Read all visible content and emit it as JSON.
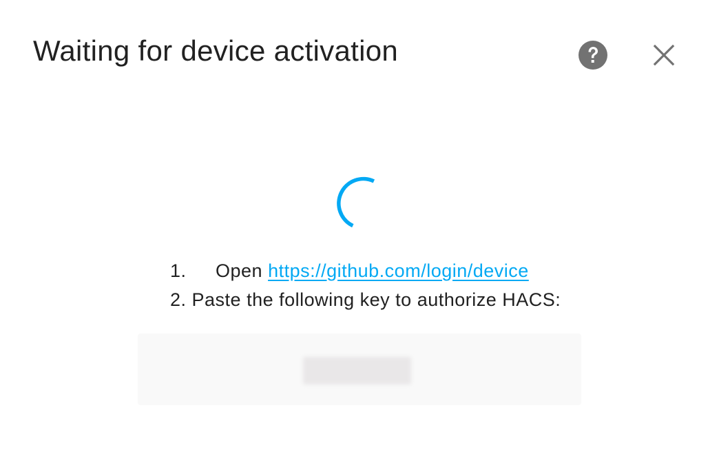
{
  "dialog": {
    "title": "Waiting for device activation",
    "help_icon": "help-circle-icon",
    "close_icon": "close-icon"
  },
  "spinner": {
    "icon": "loading-spinner-icon",
    "color": "#03a9f4"
  },
  "steps": {
    "step1_number": "1.",
    "step1_text": "Open",
    "step1_link": "https://github.com/login/device",
    "step2_text": "2. Paste the following key to authorize HACS:"
  },
  "device_code": {
    "value": ""
  },
  "colors": {
    "accent": "#03a9f4",
    "text": "#212121",
    "icon": "#727272",
    "code_background": "#f9f9f9"
  }
}
